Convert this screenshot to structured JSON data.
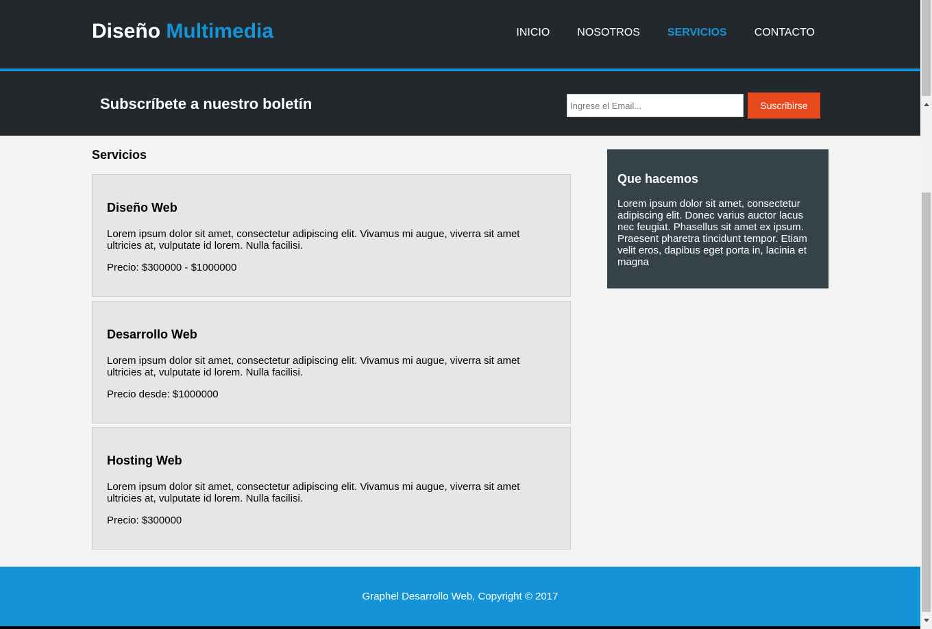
{
  "header": {
    "brand_part1": "Diseño",
    "brand_part2": "Multimedia",
    "nav": [
      {
        "label": "INICIO",
        "active": false
      },
      {
        "label": "NOSOTROS",
        "active": false
      },
      {
        "label": "SERVICIOS",
        "active": true
      },
      {
        "label": "CONTACTO",
        "active": false
      }
    ]
  },
  "newsletter": {
    "title": "Subscríbete a nuestro boletín",
    "email_placeholder": "Ingrese el Email...",
    "email_value": "",
    "button_label": "Suscribirse"
  },
  "main": {
    "title": "Servicios",
    "services": [
      {
        "name": "Diseño Web",
        "description": "Lorem ipsum dolor sit amet, consectetur adipiscing elit. Vivamus mi augue, viverra sit amet ultricies at, vulputate id lorem. Nulla facilisi.",
        "price": "Precio: $300000 - $1000000"
      },
      {
        "name": "Desarrollo Web",
        "description": "Lorem ipsum dolor sit amet, consectetur adipiscing elit. Vivamus mi augue, viverra sit amet ultricies at, vulputate id lorem. Nulla facilisi.",
        "price": "Precio desde: $1000000"
      },
      {
        "name": "Hosting Web",
        "description": "Lorem ipsum dolor sit amet, consectetur adipiscing elit. Vivamus mi augue, viverra sit amet ultricies at, vulputate id lorem. Nulla facilisi.",
        "price": "Precio: $300000"
      }
    ]
  },
  "sidebar": {
    "title": "Que hacemos",
    "text": "Lorem ipsum dolor sit amet, consectetur adipiscing elit. Donec varius auctor lacus nec feugiat. Phasellus sit amet ex ipsum. Praesent pharetra tincidunt tempor. Etiam velit eros, dapibus eget porta in, lacinia et magna"
  },
  "footer": {
    "text": "Graphel Desarrollo Web, Copyright © 2017"
  },
  "colors": {
    "dark": "#23282d",
    "accent": "#1493d6",
    "button": "#e8491d",
    "sidebar": "#35424a",
    "card": "#e6e6e6"
  }
}
